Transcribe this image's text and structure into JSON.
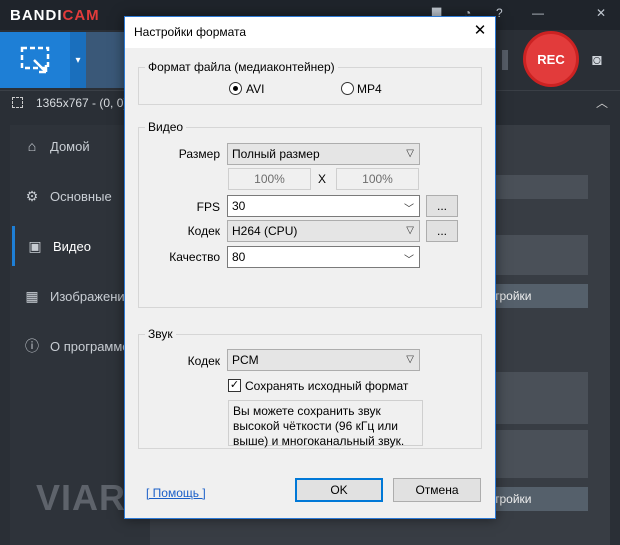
{
  "app": {
    "logo_a": "BANDI",
    "logo_b": "CAM",
    "resolution_text": "1365x767 - (0, 0),",
    "rec_label": "REC",
    "watermark": "VIARUM",
    "icons": [
      "folder-icon",
      "clock-icon",
      "help-icon",
      "minimize-icon",
      "close-icon",
      "camera-icon"
    ]
  },
  "sidebar": {
    "items": [
      {
        "label": "Домой",
        "icon": "home-icon"
      },
      {
        "label": "Основные",
        "icon": "gear-icon"
      },
      {
        "label": "Видео",
        "icon": "video-icon"
      },
      {
        "label": "Изображения",
        "icon": "image-icon"
      },
      {
        "label": "О программе",
        "icon": "info-icon"
      }
    ],
    "active_index": 2
  },
  "background_buttons": {
    "settings1": "тройки",
    "settings2": "тройки"
  },
  "dialog": {
    "title": "Настройки формата",
    "format_group": {
      "label": "Формат файла (медиаконтейнер)",
      "options": [
        "AVI",
        "MP4"
      ],
      "selected": "AVI"
    },
    "video_group": {
      "label": "Видео",
      "size_label": "Размер",
      "size_value": "Полный размер",
      "width_pct": "100%",
      "x_sep": "X",
      "height_pct": "100%",
      "fps_label": "FPS",
      "fps_value": "30",
      "codec_label": "Кодек",
      "codec_value": "H264 (CPU)",
      "quality_label": "Качество",
      "quality_value": "80",
      "more_label": "..."
    },
    "audio_group": {
      "label": "Звук",
      "codec_label": "Кодек",
      "codec_value": "PCM",
      "keep_format_label": "Сохранять исходный формат",
      "keep_format_checked": true,
      "note": "Вы можете сохранить звук высокой чёткости (96 кГц или выше) и многоканальный звук."
    },
    "help_link": "[ Помощь ]",
    "ok_label": "OK",
    "cancel_label": "Отмена"
  },
  "colors": {
    "accent_blue": "#1e7fd6",
    "rec_red": "#e23b3b",
    "dark_bg": "#2a2f36"
  }
}
